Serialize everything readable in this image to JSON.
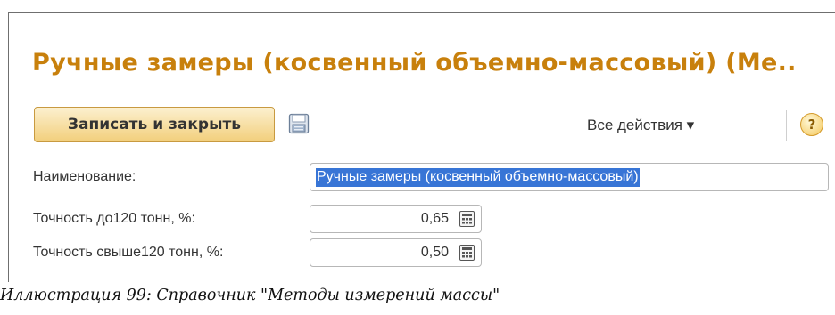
{
  "form": {
    "title": "Ручные замеры (косвенный объемно-массовый) (Ме..",
    "toolbar": {
      "save_close_label": "Записать и закрыть",
      "all_actions_label": "Все действия ▾",
      "help_label": "?"
    },
    "fields": {
      "name": {
        "label": "Наименование:",
        "value": "Ручные замеры (косвенный объемно-массовый)"
      },
      "accuracy_under_120": {
        "label": "Точность до120 тонн, %:",
        "value": "0,65"
      },
      "accuracy_over_120": {
        "label": "Точность свыше120 тонн, %:",
        "value": "0,50"
      }
    }
  },
  "icons": {
    "save": "floppy-disk-icon",
    "calculator": "calculator-icon",
    "help": "help-icon"
  },
  "colors": {
    "title": "#c8800c",
    "primary_button": "#f2cf7c",
    "selection": "#3875d6"
  },
  "caption": "Иллюстрация 99: Справочник \"Методы измерений массы\""
}
